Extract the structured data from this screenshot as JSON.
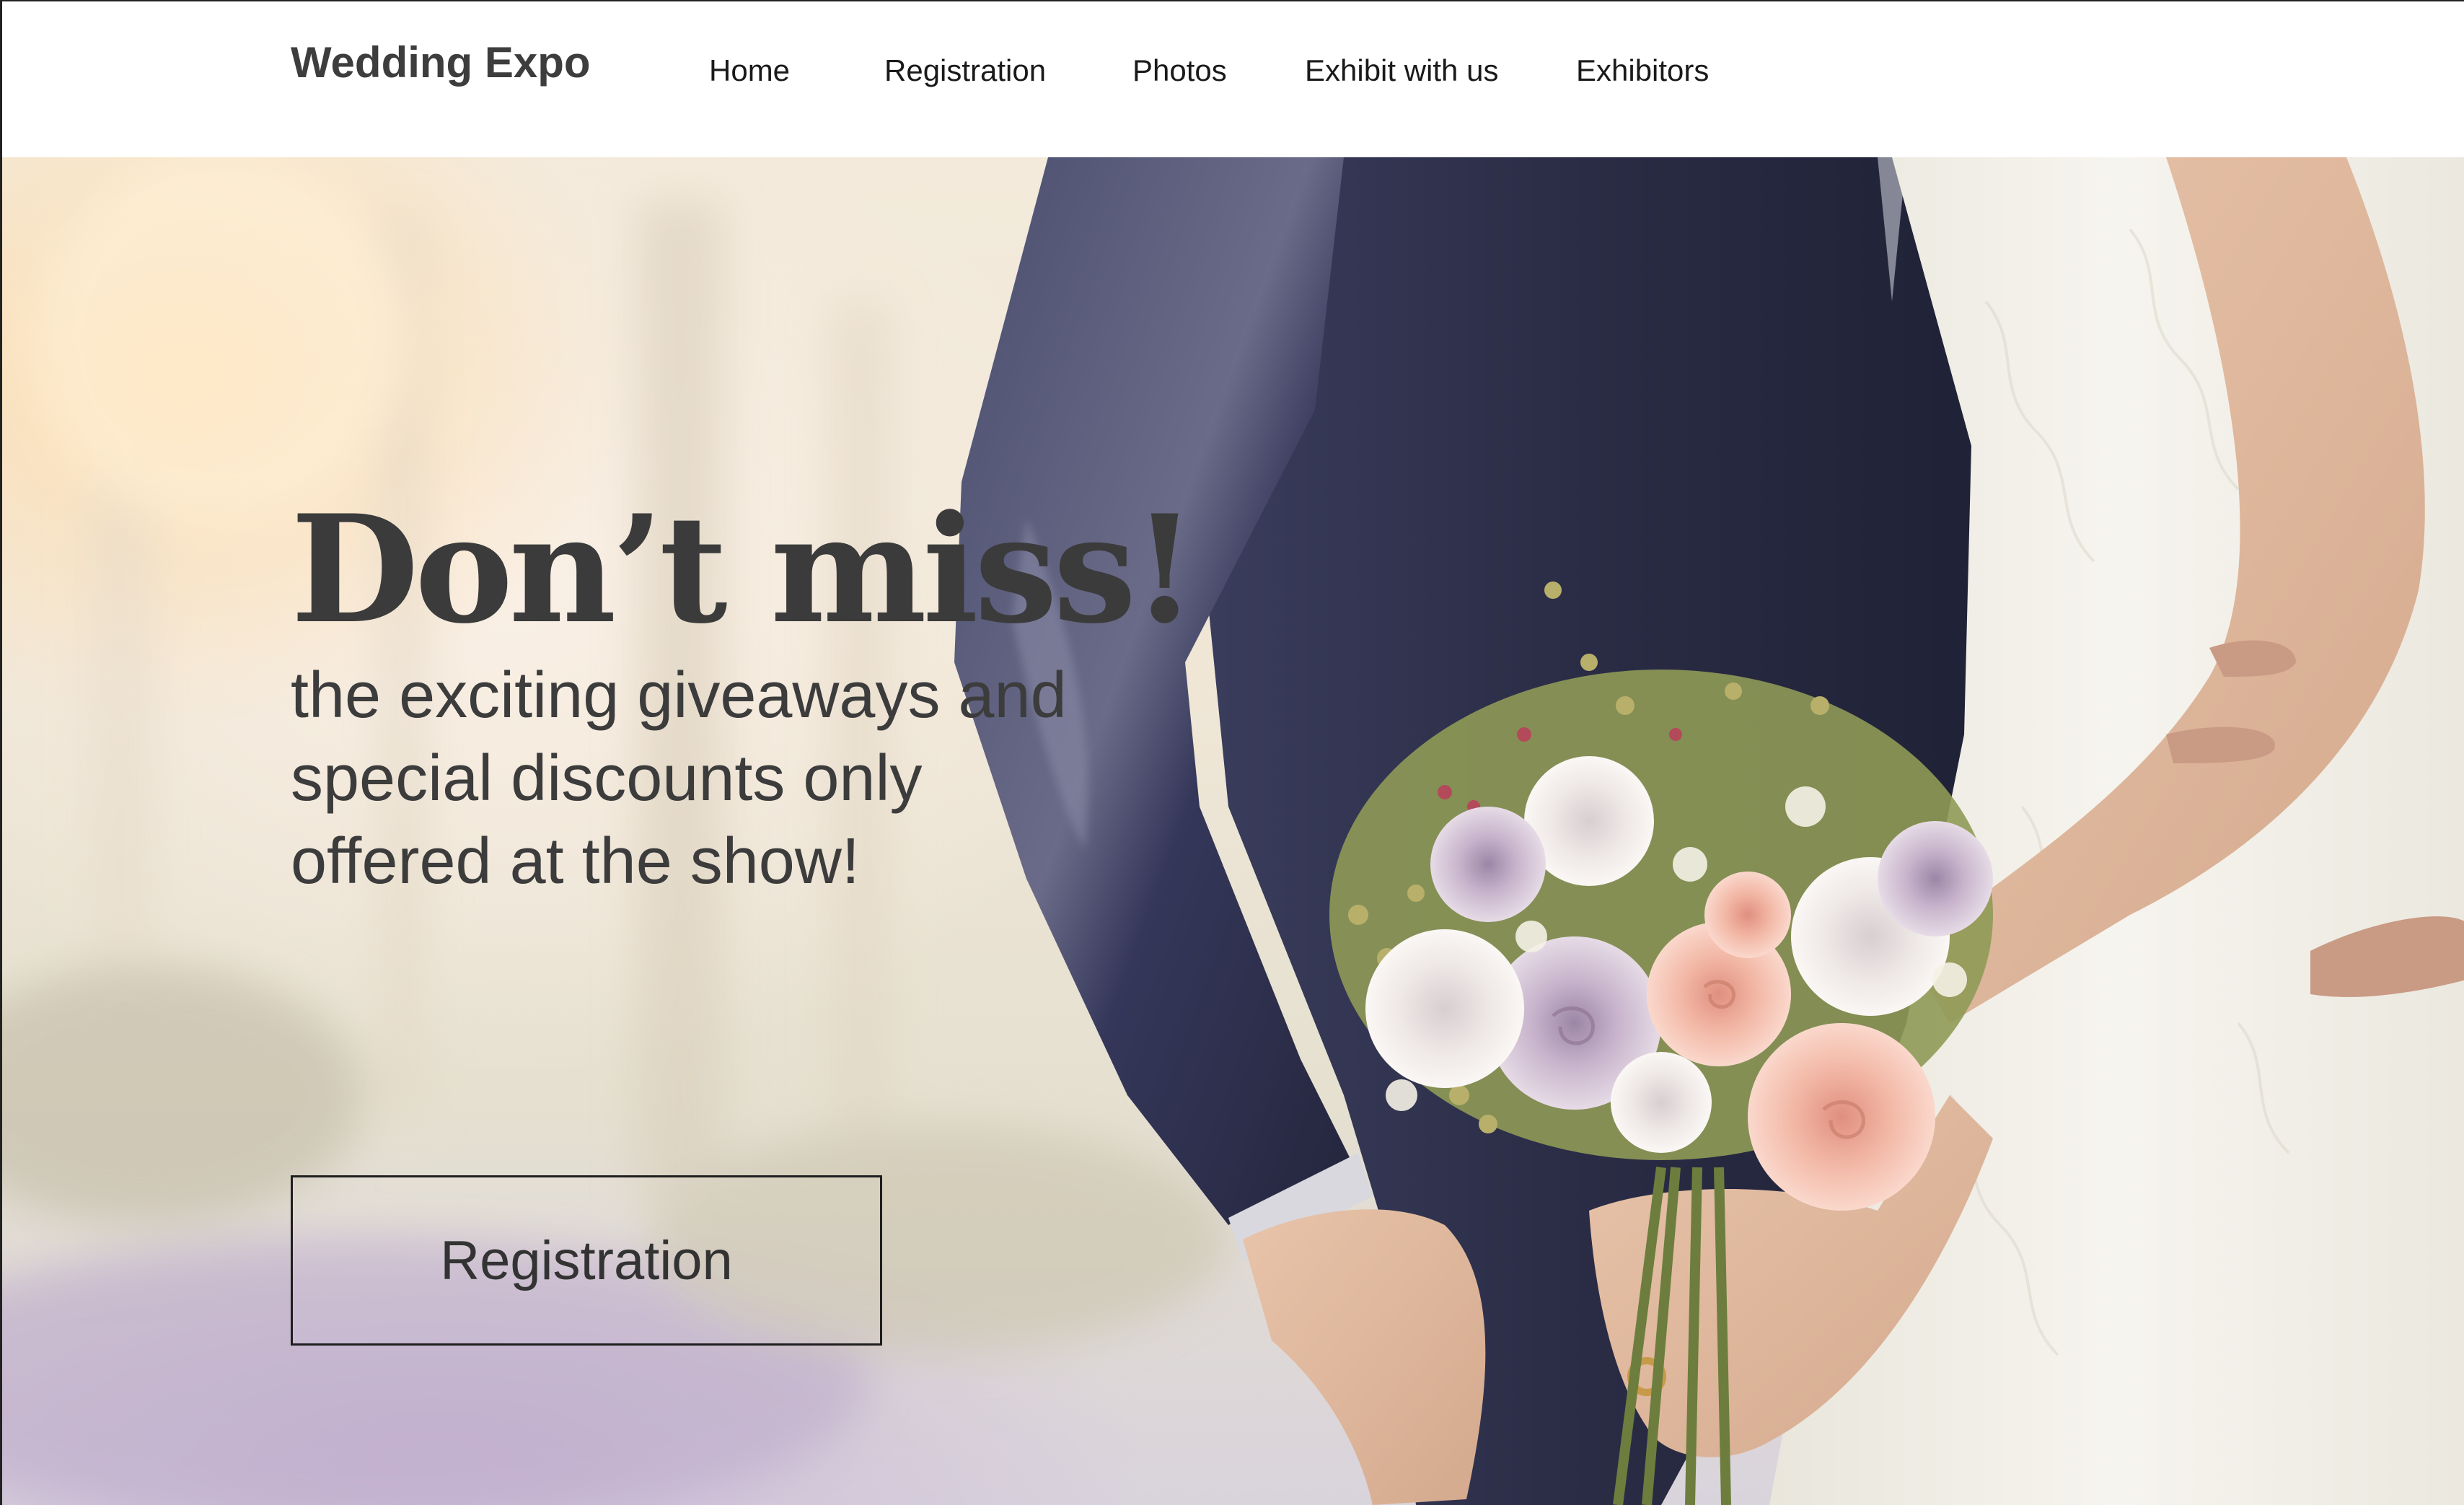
{
  "header": {
    "logo": "Wedding Expo",
    "nav": [
      "Home",
      "Registration",
      "Photos",
      "Exhibit with us",
      "Exhibitors"
    ]
  },
  "hero": {
    "headline": "Don’t miss!",
    "subtext": "the exciting giveaways and special discounts only offered at the show!",
    "cta_label": "Registration",
    "image": "wedding-couple-bouquet-photo"
  },
  "colors": {
    "text": "#3b3b3b",
    "nav_text": "#1a1a1a",
    "suit": "#2d2f4a",
    "dress": "#f2f0e8"
  }
}
